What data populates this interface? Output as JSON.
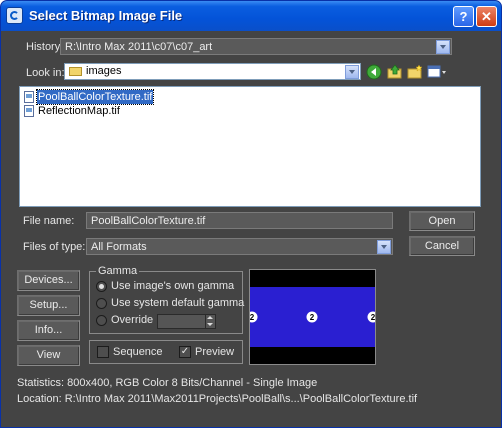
{
  "window": {
    "title": "Select Bitmap Image File",
    "help_label": "?",
    "close_label": "✕"
  },
  "history": {
    "label": "History:",
    "value": "R:\\Intro Max 2011\\c07\\c07_art"
  },
  "look_in": {
    "label": "Look in:",
    "value": "images",
    "toolbar_icons": [
      "back-icon",
      "up-folder-icon",
      "new-folder-icon",
      "view-menu-icon"
    ]
  },
  "files": [
    {
      "name": "PoolBallColorTexture.tif",
      "selected": true
    },
    {
      "name": "ReflectionMap.tif",
      "selected": false
    }
  ],
  "file_name": {
    "label": "File name:",
    "value": "PoolBallColorTexture.tif"
  },
  "files_of_type": {
    "label": "Files of type:",
    "value": "All Formats"
  },
  "buttons": {
    "open": "Open",
    "cancel": "Cancel",
    "devices": "Devices...",
    "setup": "Setup...",
    "info": "Info...",
    "view": "View"
  },
  "gamma": {
    "title": "Gamma",
    "opt_own": "Use image's own gamma",
    "opt_system": "Use system default gamma",
    "opt_override": "Override",
    "selected": "own"
  },
  "sequence_label": "Sequence",
  "preview_label": "Preview",
  "preview_checked": true,
  "sequence_checked": false,
  "preview_image": {
    "ball_number": "2",
    "band_color": "#2a1fd1",
    "background_color": "#000000",
    "ball_color": "#ffffff"
  },
  "statistics": "Statistics:  800x400, RGB Color 8 Bits/Channel - Single Image",
  "location": "Location:  R:\\Intro Max 2011\\Max2011Projects\\PoolBall\\s...\\PoolBallColorTexture.tif"
}
